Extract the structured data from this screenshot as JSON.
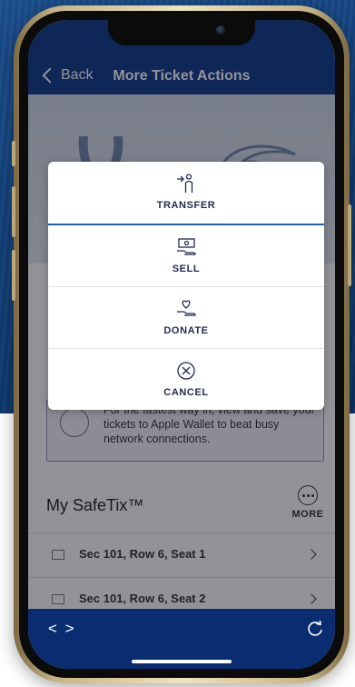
{
  "header": {
    "back_label": "Back",
    "title": "More Ticket Actions"
  },
  "actions": [
    {
      "label": "TRANSFER",
      "icon": "transfer-icon"
    },
    {
      "label": "SELL",
      "icon": "sell-icon"
    },
    {
      "label": "DONATE",
      "icon": "donate-icon"
    },
    {
      "label": "CANCEL",
      "icon": "cancel-icon"
    }
  ],
  "wallet_banner": {
    "text": "For the fastest way in, view and save your tickets to Apple Wallet to beat busy network connections."
  },
  "safetix": {
    "title": "My SafeTix™",
    "more_label": "MORE"
  },
  "seats": [
    {
      "label": "Sec 101, Row 6, Seat 1"
    },
    {
      "label": "Sec 101, Row 6, Seat 2"
    }
  ],
  "bottom_bar": {
    "code_label": "< >"
  },
  "colors": {
    "header": "#0d3b8a",
    "bottom_bar": "#0a2d72",
    "accent": "#1a5fb8",
    "phone_frame": "#c7b486"
  }
}
